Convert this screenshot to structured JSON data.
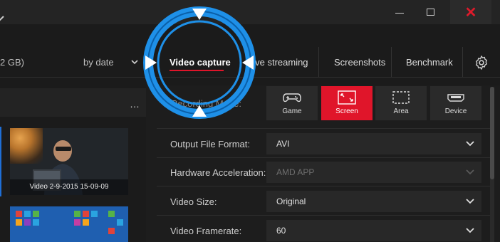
{
  "titlebar": {
    "close_glyph": "✕"
  },
  "library": {
    "storage_text": "2 GB)",
    "sort_label": "by date",
    "more_glyph": "…",
    "videos": [
      {
        "caption": "Video 2-9-2015 15-09-09"
      },
      {
        "caption": ""
      }
    ]
  },
  "tabs": [
    {
      "label": "Video capture",
      "active": true
    },
    {
      "label": "Live streaming",
      "active": false
    },
    {
      "label": "Screenshots",
      "active": false
    },
    {
      "label": "Benchmark",
      "active": false
    }
  ],
  "recording_mode": {
    "label": "Recording Mode:",
    "options": [
      {
        "label": "Game",
        "icon": "gamepad-icon",
        "selected": false
      },
      {
        "label": "Screen",
        "icon": "screen-icon",
        "selected": true
      },
      {
        "label": "Area",
        "icon": "area-icon",
        "selected": false
      },
      {
        "label": "Device",
        "icon": "hdmi-icon",
        "selected": false
      }
    ]
  },
  "settings": [
    {
      "label": "Output File Format:",
      "value": "AVI",
      "disabled": false
    },
    {
      "label": "Hardware Acceleration:",
      "value": "AMD APP",
      "disabled": true
    },
    {
      "label": "Video Size:",
      "value": "Original",
      "disabled": false
    },
    {
      "label": "Video Framerate:",
      "value": "60",
      "disabled": false
    }
  ],
  "colors": {
    "accent": "#e0152a",
    "overlay": "#1e90e8",
    "background": "#1d1d1d"
  }
}
